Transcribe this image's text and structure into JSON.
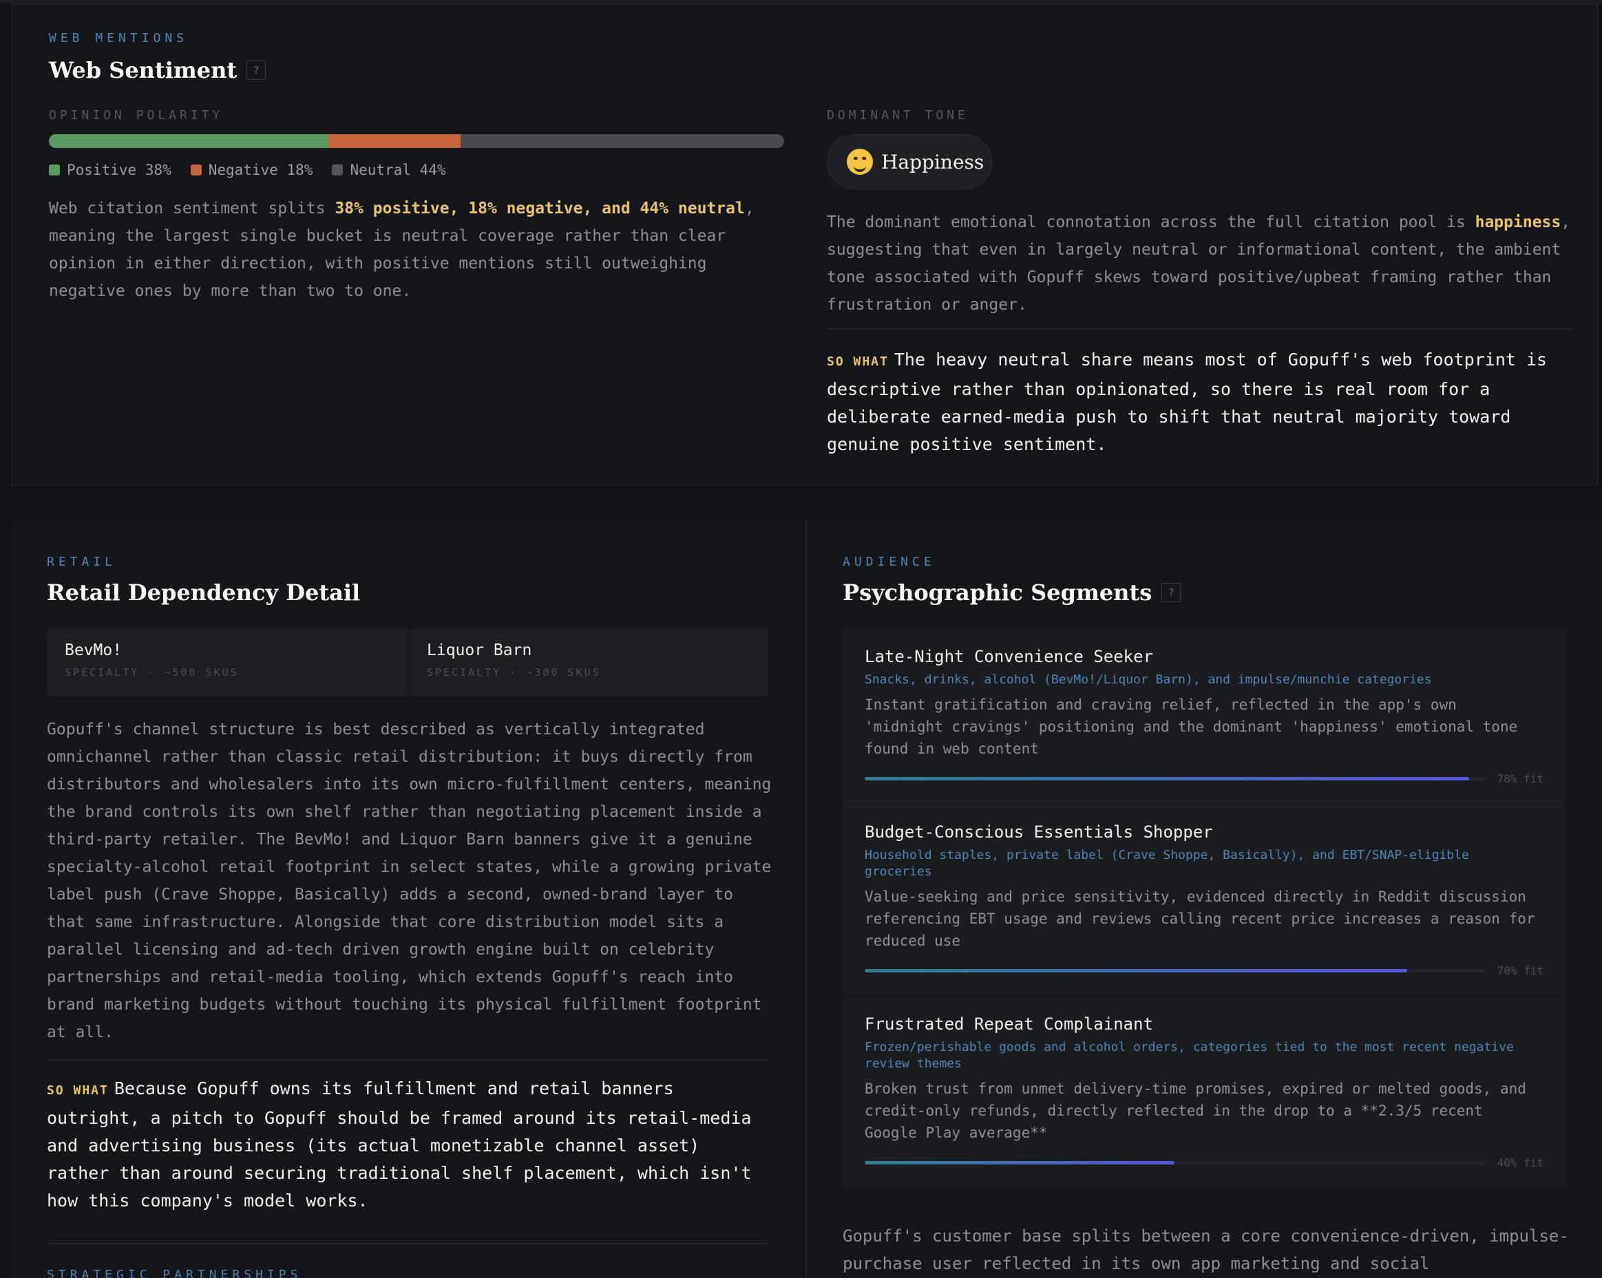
{
  "sentiment": {
    "eyebrow": "WEB MENTIONS",
    "title": "Web Sentiment",
    "help": "?",
    "polarity_label": "OPINION POLARITY",
    "polarity": [
      {
        "name": "Positive",
        "pct": 38,
        "display": "Positive 38%",
        "color": "#5b9a63"
      },
      {
        "name": "Negative",
        "pct": 18,
        "display": "Negative 18%",
        "color": "#c8643c"
      },
      {
        "name": "Neutral",
        "pct": 44,
        "display": "Neutral 44%",
        "color": "#4a4b50"
      }
    ],
    "summary_pre": "Web citation sentiment splits ",
    "summary_hl": "38% positive, 18% negative, and 44% neutral",
    "summary_post": ", meaning the largest single bucket is neutral coverage rather than clear opinion in either direction, with positive mentions still outweighing negative ones by more than two to one.",
    "tone_label": "DOMINANT TONE",
    "tone_emoji": "smiling-face-icon",
    "tone_value": "Happiness",
    "tone_pre": "The dominant emotional connotation across the full citation pool is ",
    "tone_hl": "happiness",
    "tone_post": ", suggesting that even in largely neutral or informational content, the ambient tone associated with Gopuff skews toward positive/upbeat framing rather than frustration or anger.",
    "sowhat_tag": "SO WHAT",
    "sowhat_text": "The heavy neutral share means most of Gopuff's web footprint is descriptive rather than opinionated, so there is real room for a deliberate earned-media push to shift that neutral majority toward genuine positive sentiment."
  },
  "retail": {
    "eyebrow": "RETAIL",
    "title": "Retail Dependency Detail",
    "brands": [
      {
        "name": "BevMo!",
        "meta": "SPECIALTY · ~500 SKUS"
      },
      {
        "name": "Liquor Barn",
        "meta": "SPECIALTY · ~300 SKUS"
      }
    ],
    "body": "Gopuff's channel structure is best described as vertically integrated omnichannel rather than classic retail distribution: it buys directly from distributors and wholesalers into its own micro-fulfillment centers, meaning the brand controls its own shelf rather than negotiating placement inside a third-party retailer. The BevMo! and Liquor Barn banners give it a genuine specialty-alcohol retail footprint in select states, while a growing private label push (Crave Shoppe, Basically) adds a second, owned-brand layer to that same infrastructure. Alongside that core distribution model sits a parallel licensing and ad-tech driven growth engine built on celebrity partnerships and retail-media tooling, which extends Gopuff's reach into brand marketing budgets without touching its physical fulfillment footprint at all.",
    "sowhat_tag": "SO WHAT",
    "sowhat_text": "Because Gopuff owns its fulfillment and retail banners outright, a pitch to Gopuff should be framed around its retail-media and advertising business (its actual monetizable channel asset) rather than around securing traditional shelf placement, which isn't how this company's model works.",
    "next_eyebrow": "STRATEGIC PARTNERSHIPS"
  },
  "audience": {
    "eyebrow": "AUDIENCE",
    "title": "Psychographic Segments",
    "help": "?",
    "segments": [
      {
        "name": "Late-Night Convenience Seeker",
        "categories": "Snacks, drinks, alcohol (BevMo!/Liquor Barn), and impulse/munchie categories",
        "description": "Instant gratification and craving relief, reflected in the app's own 'midnight cravings' positioning and the dominant 'happiness' emotional tone found in web content",
        "fit": 78,
        "fit_label": "78% fit"
      },
      {
        "name": "Budget-Conscious Essentials Shopper",
        "categories": "Household staples, private label (Crave Shoppe, Basically), and EBT/SNAP-eligible groceries",
        "description": "Value-seeking and price sensitivity, evidenced directly in Reddit discussion referencing EBT usage and reviews calling recent price increases a reason for reduced use",
        "fit": 70,
        "fit_label": "70% fit"
      },
      {
        "name": "Frustrated Repeat Complainant",
        "categories": "Frozen/perishable goods and alcohol orders, categories tied to the most recent negative review themes",
        "description": "Broken trust from unmet delivery-time promises, expired or melted goods, and credit-only refunds, directly reflected in the drop to a **2.3/5 recent Google Play average**",
        "fit": 40,
        "fit_label": "40% fit"
      }
    ],
    "summary": "Gopuff's customer base splits between a core convenience-driven, impulse-purchase user reflected in its own app marketing and social"
  }
}
